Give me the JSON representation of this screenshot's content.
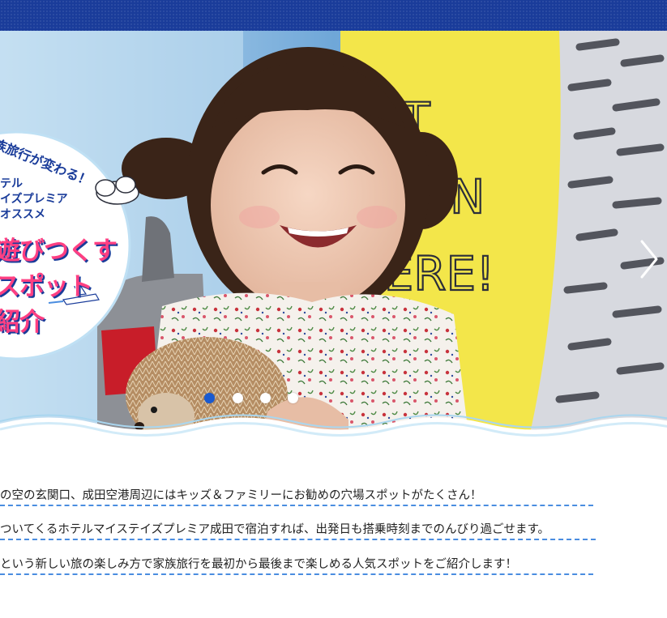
{
  "hero": {
    "badge": {
      "tagline": "族旅行が変わる！",
      "sub_line1": "テル",
      "sub_line2": "イズプレミア",
      "sub_line3": "オススメ",
      "big_line1": "遊びつくす",
      "big_line2": "スポット",
      "big_line3": "紹介"
    },
    "wall_text": [
      "IT",
      "N",
      "HERE!"
    ],
    "next_icon": "chevron-right-icon",
    "slides_total": 4,
    "active_slide": 1
  },
  "intro": {
    "lines": [
      "の空の玄関口、成田空港周辺にはキッズ＆ファミリーにお勧めの穴場スポットがたくさん！",
      "ついてくるホテルマイステイズプレミア成田で宿泊すれば、出発日も搭乗時刻までのんびり過ごせます。",
      "という新しい旅の楽しみ方で家族旅行を最初から最後まで楽しめる人気スポットをご紹介します！"
    ]
  },
  "colors": {
    "header": "#1a3c9a",
    "accent_pink": "#ff3f82",
    "dash_underline": "#4a8de0",
    "dot_active": "#1a5ad0"
  }
}
